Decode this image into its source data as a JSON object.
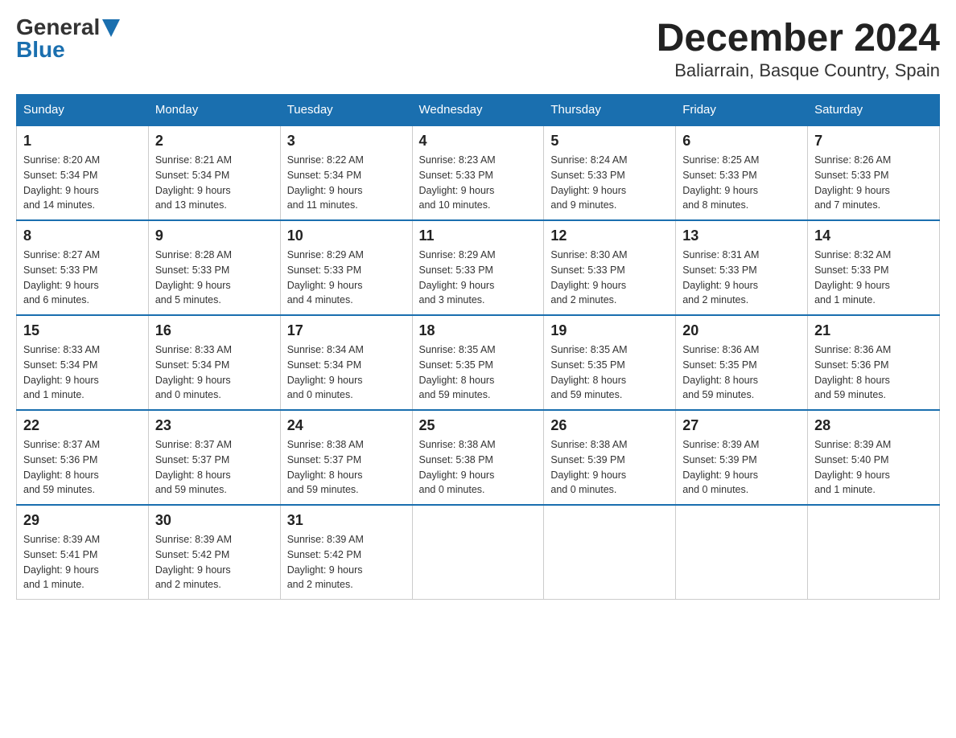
{
  "header": {
    "logo_general": "General",
    "logo_blue": "Blue",
    "title": "December 2024",
    "subtitle": "Baliarrain, Basque Country, Spain"
  },
  "days_of_week": [
    "Sunday",
    "Monday",
    "Tuesday",
    "Wednesday",
    "Thursday",
    "Friday",
    "Saturday"
  ],
  "weeks": [
    [
      {
        "day": "1",
        "sunrise": "8:20 AM",
        "sunset": "5:34 PM",
        "daylight": "9 hours and 14 minutes."
      },
      {
        "day": "2",
        "sunrise": "8:21 AM",
        "sunset": "5:34 PM",
        "daylight": "9 hours and 13 minutes."
      },
      {
        "day": "3",
        "sunrise": "8:22 AM",
        "sunset": "5:34 PM",
        "daylight": "9 hours and 11 minutes."
      },
      {
        "day": "4",
        "sunrise": "8:23 AM",
        "sunset": "5:33 PM",
        "daylight": "9 hours and 10 minutes."
      },
      {
        "day": "5",
        "sunrise": "8:24 AM",
        "sunset": "5:33 PM",
        "daylight": "9 hours and 9 minutes."
      },
      {
        "day": "6",
        "sunrise": "8:25 AM",
        "sunset": "5:33 PM",
        "daylight": "9 hours and 8 minutes."
      },
      {
        "day": "7",
        "sunrise": "8:26 AM",
        "sunset": "5:33 PM",
        "daylight": "9 hours and 7 minutes."
      }
    ],
    [
      {
        "day": "8",
        "sunrise": "8:27 AM",
        "sunset": "5:33 PM",
        "daylight": "9 hours and 6 minutes."
      },
      {
        "day": "9",
        "sunrise": "8:28 AM",
        "sunset": "5:33 PM",
        "daylight": "9 hours and 5 minutes."
      },
      {
        "day": "10",
        "sunrise": "8:29 AM",
        "sunset": "5:33 PM",
        "daylight": "9 hours and 4 minutes."
      },
      {
        "day": "11",
        "sunrise": "8:29 AM",
        "sunset": "5:33 PM",
        "daylight": "9 hours and 3 minutes."
      },
      {
        "day": "12",
        "sunrise": "8:30 AM",
        "sunset": "5:33 PM",
        "daylight": "9 hours and 2 minutes."
      },
      {
        "day": "13",
        "sunrise": "8:31 AM",
        "sunset": "5:33 PM",
        "daylight": "9 hours and 2 minutes."
      },
      {
        "day": "14",
        "sunrise": "8:32 AM",
        "sunset": "5:33 PM",
        "daylight": "9 hours and 1 minute."
      }
    ],
    [
      {
        "day": "15",
        "sunrise": "8:33 AM",
        "sunset": "5:34 PM",
        "daylight": "9 hours and 1 minute."
      },
      {
        "day": "16",
        "sunrise": "8:33 AM",
        "sunset": "5:34 PM",
        "daylight": "9 hours and 0 minutes."
      },
      {
        "day": "17",
        "sunrise": "8:34 AM",
        "sunset": "5:34 PM",
        "daylight": "9 hours and 0 minutes."
      },
      {
        "day": "18",
        "sunrise": "8:35 AM",
        "sunset": "5:35 PM",
        "daylight": "8 hours and 59 minutes."
      },
      {
        "day": "19",
        "sunrise": "8:35 AM",
        "sunset": "5:35 PM",
        "daylight": "8 hours and 59 minutes."
      },
      {
        "day": "20",
        "sunrise": "8:36 AM",
        "sunset": "5:35 PM",
        "daylight": "8 hours and 59 minutes."
      },
      {
        "day": "21",
        "sunrise": "8:36 AM",
        "sunset": "5:36 PM",
        "daylight": "8 hours and 59 minutes."
      }
    ],
    [
      {
        "day": "22",
        "sunrise": "8:37 AM",
        "sunset": "5:36 PM",
        "daylight": "8 hours and 59 minutes."
      },
      {
        "day": "23",
        "sunrise": "8:37 AM",
        "sunset": "5:37 PM",
        "daylight": "8 hours and 59 minutes."
      },
      {
        "day": "24",
        "sunrise": "8:38 AM",
        "sunset": "5:37 PM",
        "daylight": "8 hours and 59 minutes."
      },
      {
        "day": "25",
        "sunrise": "8:38 AM",
        "sunset": "5:38 PM",
        "daylight": "9 hours and 0 minutes."
      },
      {
        "day": "26",
        "sunrise": "8:38 AM",
        "sunset": "5:39 PM",
        "daylight": "9 hours and 0 minutes."
      },
      {
        "day": "27",
        "sunrise": "8:39 AM",
        "sunset": "5:39 PM",
        "daylight": "9 hours and 0 minutes."
      },
      {
        "day": "28",
        "sunrise": "8:39 AM",
        "sunset": "5:40 PM",
        "daylight": "9 hours and 1 minute."
      }
    ],
    [
      {
        "day": "29",
        "sunrise": "8:39 AM",
        "sunset": "5:41 PM",
        "daylight": "9 hours and 1 minute."
      },
      {
        "day": "30",
        "sunrise": "8:39 AM",
        "sunset": "5:42 PM",
        "daylight": "9 hours and 2 minutes."
      },
      {
        "day": "31",
        "sunrise": "8:39 AM",
        "sunset": "5:42 PM",
        "daylight": "9 hours and 2 minutes."
      },
      null,
      null,
      null,
      null
    ]
  ],
  "labels": {
    "sunrise": "Sunrise:",
    "sunset": "Sunset:",
    "daylight": "Daylight:"
  }
}
